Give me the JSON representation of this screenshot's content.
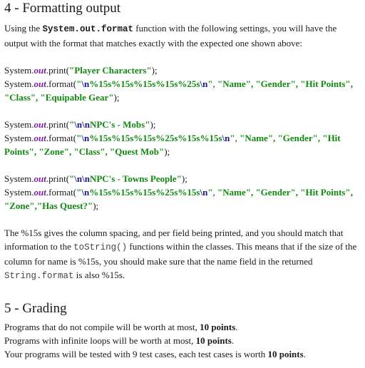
{
  "section4": {
    "heading": "4 - Formatting output",
    "intro": {
      "before": "Using the ",
      "code": "System.out.format",
      "after": " function with the following settings, you will have the output with the format that matches exactly with the expected one shown above:"
    },
    "code_blocks": [
      {
        "print_label": "\"Player Characters\"",
        "print_escape": "",
        "format_escape_start": "\\n",
        "format_spec": "%15s%15s%15s%15s%25s",
        "format_escape_end": "\\n",
        "args_line1": "\"Name\", \"Gender\", \"Hit Points\",",
        "args_line2": "\"Class\", \"Equipable Gear\""
      },
      {
        "print_escape": "\\n\\n",
        "print_label": "NPC's - Mobs\"",
        "format_escape_start": "\\n",
        "format_spec": "%15s%15s%15s%25s%15s%15s",
        "format_escape_end": "\\n",
        "args_line1": "\"Name\", \"Gender\", \"Hit",
        "args_line2": "Points\", \"Zone\", \"Class\", \"Quest Mob\""
      },
      {
        "print_escape": "\\n\\n",
        "print_label": "NPC's - Towns People\"",
        "format_escape_start": "\\n",
        "format_spec": "%15s%15s%15s%25s%15s",
        "format_escape_end": "\\n",
        "args_line1": "\"Name\", \"Gender\", \"Hit Points\",",
        "args_line2": "\"Zone\",\"Has Quest?\""
      }
    ],
    "code_tokens": {
      "system": "System.",
      "out": "out",
      "print": ".print(",
      "format": ".format(",
      "quote": "\"",
      "close": ");",
      "sep": ", "
    },
    "explanation": {
      "part1": "The %15s gives the column spacing, and per field being printed, and you should match that information to the ",
      "code1": "toString()",
      "part2": " functions within the classes. This means that if the size of the column for name is %15s, you should make sure that the name field in the returned ",
      "code2": "String.format",
      "part3": " is also %15s."
    }
  },
  "section5": {
    "heading": "5 - Grading",
    "lines": [
      {
        "text": "Programs that do not compile will be worth at most, ",
        "bold": "10 points",
        "end": "."
      },
      {
        "text": "Programs with infinite loops will be worth at most, ",
        "bold": "10 points",
        "end": "."
      },
      {
        "text": "Your programs will be tested with 9 test cases, each test cases is worth ",
        "bold": "10 points",
        "end": "."
      }
    ]
  }
}
